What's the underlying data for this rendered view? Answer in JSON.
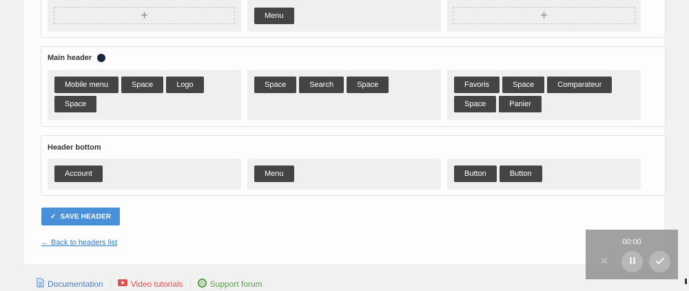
{
  "top_row": {
    "left_add_glyph": "+",
    "center_items": [
      "Menu"
    ],
    "right_add_glyph": "+"
  },
  "main_header": {
    "title": "Main header",
    "left_items": [
      "Mobile menu",
      "Space",
      "Logo",
      "Space"
    ],
    "center_items": [
      "Space",
      "Search",
      "Space"
    ],
    "right_items": [
      "Favoris",
      "Space",
      "Comparateur",
      "Space",
      "Panier"
    ]
  },
  "header_bottom": {
    "title": "Header bottom",
    "left_items": [
      "Account"
    ],
    "center_items": [
      "Menu"
    ],
    "right_items": [
      "Button",
      "Button"
    ]
  },
  "save_label": "SAVE HEADER",
  "back_label": "← Back to headers list",
  "footer": {
    "documentation": "Documentation",
    "video_tutorials": "Video tutorials",
    "support_forum": "Support forum"
  },
  "recorder": {
    "time": "00:00"
  },
  "colors": {
    "accent": "#4a90d9",
    "chip": "#444444",
    "link": "#2f7bc2",
    "video": "#d9534f",
    "forum": "#5a9e4b"
  },
  "icons": [
    "plus-icon",
    "check-icon",
    "document-icon",
    "youtube-icon",
    "lifebuoy-icon",
    "close-icon",
    "pause-icon",
    "checkmark-icon"
  ]
}
